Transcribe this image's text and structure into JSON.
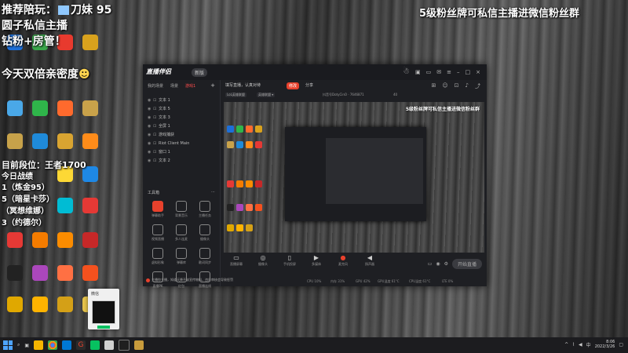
{
  "overlay": {
    "line1_prefix": "推荐陪玩：",
    "line1_name": "刀妹",
    "line1_num": "95",
    "line2": "圆子私信主播",
    "line3": "钻粉+房管！",
    "line4": "今天双倍亲密度",
    "top_right": "5级粉丝牌可私信主播进微信粉丝群",
    "rank_line": "目前段位：王者1700",
    "battle_title": "今日战绩",
    "battle_1": "1（炼金95）",
    "battle_2": "5（暗星卡莎）",
    "battle_3": "（冥想维娜）",
    "battle_4": "3（约德尔）"
  },
  "app": {
    "logo": "直播伴侣",
    "version": "新版",
    "scene_tabs": [
      "我的场景",
      "场景",
      "游戏1"
    ],
    "layers": [
      "文本 1",
      "文本 5",
      "文本 3",
      "全屏 1",
      "游戏捕获",
      "Riot Client Main",
      "窗口 1",
      "文本 2"
    ],
    "tools_title": "工具箱",
    "tools": [
      "弹幕助手",
      "背景音乐",
      "主播任务",
      "视频直播",
      "多人连麦",
      "摄像头",
      "虚拟形象",
      "弹幕库",
      "歌词同步",
      "直播PK",
      "红包",
      "直播连线"
    ],
    "topic_label": "填写直播，认真对待",
    "modify": "修改",
    "share": "分享",
    "info_tags": [
      "LoL英雄联盟",
      "英雄联盟 ▾"
    ],
    "room_info": "抖音号DotyCinO · 7646871",
    "room_count": "40",
    "preview_text": "5级粉丝牌可私信主播进微信粉丝群",
    "bottom_tools": [
      "直播屏幕",
      "摄像头",
      "手机投屏",
      "多媒体",
      "麦克风",
      "扬声器"
    ],
    "start_button": "开始直播",
    "status": [
      "CPU 10%",
      "内存 31%",
      "GPU 42%",
      "GPU温度 61°C",
      "CPU温度 61°C",
      "LTE 0%"
    ],
    "notice": "主播你主播，知道天降不该宣传物料，违反审核会导致惩罚"
  },
  "wechat_popup": {
    "title": "微信"
  },
  "taskbar": {
    "time": "8:06",
    "date": "2022/3/26"
  }
}
